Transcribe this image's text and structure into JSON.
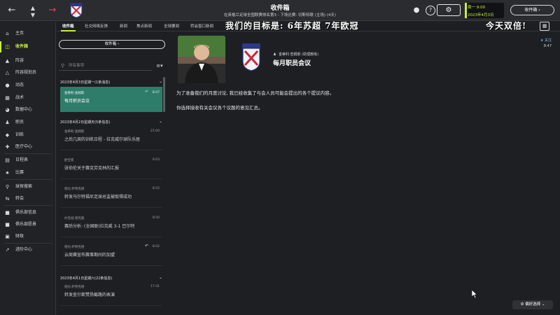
{
  "colors": {
    "accent": "#c8f03c",
    "selected": "#2e7d6a",
    "brand_red": "#d94a62",
    "link": "#7eb6ff"
  },
  "topbar": {
    "back_icon": "arrow-left-icon",
    "title": "收件箱",
    "subtitle": "在英格兰足球全国联赛排名第3 - 下场比赛: 切斯特联 (主场) (4天)",
    "date_line1": "周一 9:00",
    "date_line2": "2023年4月3日",
    "continue_label": "收件箱"
  },
  "sidebar": {
    "items": [
      {
        "label": "主页",
        "icon": "home-icon"
      },
      {
        "label": "收件箱",
        "icon": "inbox-icon"
      },
      {
        "label": "阵容",
        "icon": "shirt-icon"
      },
      {
        "label": "阵容规划员",
        "icon": "shirt-plan-icon"
      },
      {
        "label": "动态",
        "icon": "news-icon"
      },
      {
        "label": "战术",
        "icon": "tactics-icon"
      },
      {
        "label": "数据中心",
        "icon": "data-icon"
      },
      {
        "label": "职员",
        "icon": "staff-icon"
      },
      {
        "label": "训练",
        "icon": "training-icon"
      },
      {
        "label": "医疗中心",
        "icon": "medical-icon"
      },
      {
        "label": "日程表",
        "icon": "calendar-icon"
      },
      {
        "label": "比赛",
        "icon": "trophy-icon"
      },
      {
        "label": "球探搜索",
        "icon": "scouting-icon"
      },
      {
        "label": "转会",
        "icon": "transfer-icon"
      },
      {
        "label": "俱乐部信息",
        "icon": "club-info-icon"
      },
      {
        "label": "俱乐部愿景",
        "icon": "club-vision-icon"
      },
      {
        "label": "财政",
        "icon": "finance-icon"
      },
      {
        "label": "进阶中心",
        "icon": "progress-icon"
      }
    ]
  },
  "tabs": [
    "收件箱",
    "社交网络反馈",
    "新闻",
    "焦点新闻",
    "全球要闻",
    "转会窗口新闻"
  ],
  "overlay": {
    "main": "我们的目标是: 6年苏超 7年欧冠",
    "right": "今天双倍!"
  },
  "list": {
    "inbox_button": "收件箱",
    "search_placeholder": "所有事项",
    "groups": [
      {
        "header": "2023年4月3日星期一(1条消息)",
        "messages": [
          {
            "sender": "金蒂利·查姆斯",
            "time": "8:47",
            "subject": "每月职员会议",
            "selected": true,
            "replied": true
          }
        ]
      },
      {
        "header": "2023年4月2日星期天(5条信息)",
        "messages": [
          {
            "sender": "金蒂利·查姆斯",
            "time": "21:00",
            "subject": "之后几周的训练日程 - 拉克威尔球队乐居",
            "selected": false,
            "replied": false
          },
          {
            "sender": "欧宝客",
            "time": "9:03",
            "subject": "张伯伦关于赛克劳克林的汇报",
            "selected": false,
            "replied": false
          },
          {
            "sender": "德比·萨特克德",
            "time": "8:52",
            "subject": "转发马尔特福尼足球总监被取得成功",
            "selected": false,
            "replied": false
          },
          {
            "sender": "约克城·德克隆",
            "time": "8:50",
            "subject": "赛后分析: (全国联)拉克威 3-1 巴尔特",
            "selected": false,
            "replied": false
          },
          {
            "sender": "德比·萨特克德",
            "time": "8:02",
            "subject": "云周赛宣布赛事期间的加盟",
            "selected": false,
            "replied": true
          }
        ]
      },
      {
        "header": "2023年4月1日星期六(22条信息)",
        "messages": [
          {
            "sender": "德比·萨特克德",
            "time": "17:41",
            "subject": "转发查尔斯赞扬截路的表演",
            "selected": false,
            "replied": false
          }
        ]
      }
    ]
  },
  "detail": {
    "sender": "金蒂利·查姆斯 (助理教练)",
    "subject": "每月职员会议",
    "follow_label": "关注",
    "time": "8:47",
    "paragraphs": [
      "为了准备我们的月度讨论, 我已经收集了与会人员可能会提出的各个提议内容。",
      "你选择接收有关会议各个议题的意见汇总。"
    ]
  },
  "footer": {
    "preferences_label": "偏好选择"
  }
}
